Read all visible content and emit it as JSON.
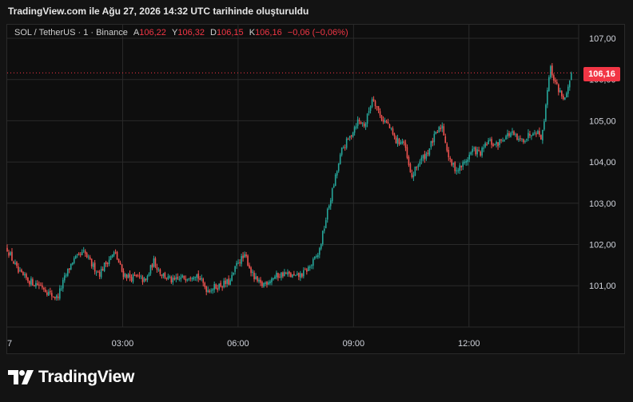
{
  "header": {
    "title": "TradingView.com ile Ağu 27, 2026 14:32 UTC tarihinde oluşturuldu"
  },
  "legend": {
    "symbol": "SOL / TetherUS · 1 · Binance",
    "open_label": "A",
    "open": "106,22",
    "high_label": "Y",
    "high": "106,32",
    "low_label": "D",
    "low": "106,15",
    "close_label": "K",
    "close": "106,16",
    "change": "−0,06 (−0,06%)"
  },
  "last_price_tag": "106,16",
  "brand": {
    "name": "TradingView"
  },
  "colors": {
    "up": "#26a69a",
    "down": "#ef5350",
    "background": "#0e0e0e",
    "grid": "#2a2a2a",
    "price_tag": "#f23645"
  },
  "chart_data": {
    "type": "candlestick",
    "x_tick_labels": [
      "7",
      "03:00",
      "06:00",
      "09:00",
      "12:00"
    ],
    "x_ticks_hours": [
      0,
      3,
      6,
      9,
      12
    ],
    "y_tick_labels": [
      "101,00",
      "102,00",
      "103,00",
      "104,00",
      "105,00",
      "106,00",
      "107,00"
    ],
    "y_ticks": [
      101,
      102,
      103,
      104,
      105,
      106,
      107
    ],
    "ylim": [
      100.0,
      107.2
    ],
    "xlim_hours": [
      0,
      14.85
    ],
    "last_price": 106.16,
    "series_hours": [
      0,
      0.3,
      0.6,
      0.9,
      1.1,
      1.3,
      1.5,
      1.7,
      2.0,
      2.2,
      2.4,
      2.6,
      2.8,
      3.0,
      3.2,
      3.4,
      3.6,
      3.8,
      4.0,
      4.3,
      4.6,
      4.9,
      5.2,
      5.5,
      5.8,
      6.0,
      6.2,
      6.4,
      6.6,
      6.9,
      7.2,
      7.5,
      7.7,
      7.9,
      8.1,
      8.3,
      8.5,
      8.7,
      8.9,
      9.1,
      9.3,
      9.5,
      9.7,
      9.9,
      10.1,
      10.3,
      10.5,
      10.7,
      10.9,
      11.1,
      11.3,
      11.5,
      11.7,
      11.9,
      12.1,
      12.3,
      12.5,
      12.7,
      12.9,
      13.1,
      13.3,
      13.5,
      13.7,
      13.9,
      14.1,
      14.3,
      14.5,
      14.7
    ],
    "series_values": [
      101.9,
      101.3,
      101.1,
      101.0,
      100.8,
      100.7,
      101.2,
      101.6,
      101.8,
      101.5,
      101.3,
      101.6,
      101.8,
      101.3,
      101.2,
      101.2,
      101.1,
      101.6,
      101.3,
      101.1,
      101.2,
      101.3,
      100.9,
      101.0,
      101.1,
      101.6,
      101.7,
      101.2,
      101.0,
      101.2,
      101.3,
      101.2,
      101.3,
      101.5,
      101.8,
      102.7,
      103.5,
      104.3,
      104.6,
      105.0,
      104.9,
      105.6,
      105.1,
      104.9,
      104.5,
      104.5,
      103.6,
      104.0,
      104.2,
      104.6,
      104.9,
      104.0,
      103.8,
      104.0,
      104.3,
      104.2,
      104.5,
      104.4,
      104.6,
      104.7,
      104.5,
      104.6,
      104.8,
      104.6,
      106.3,
      105.8,
      105.5,
      106.16
    ]
  }
}
